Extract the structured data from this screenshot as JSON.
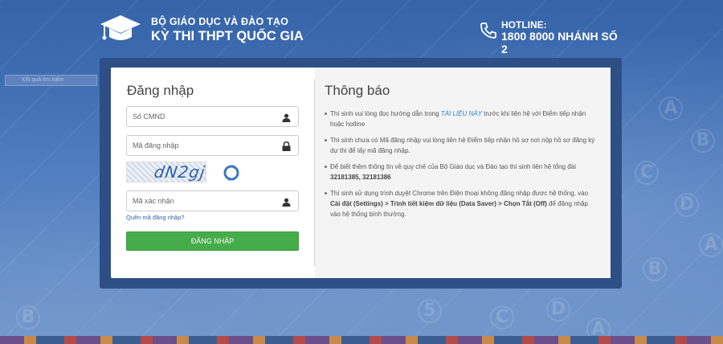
{
  "header": {
    "org": "BỘ GIÁO DỤC VÀ ĐÀO TẠO",
    "exam": "KỲ THI THPT QUỐC GIA",
    "hotline_label": "HOTLINE:",
    "hotline_number": "1800 8000 NHÁNH SỐ 2"
  },
  "login": {
    "title": "Đăng nhập",
    "id_placeholder": "Số CMND",
    "login_code_placeholder": "Mã đăng nhập",
    "captcha_text": "dN2gj",
    "captcha_input_placeholder": "Mã xác nhận",
    "forgot_link": "Quên mã đăng nhập?",
    "submit_label": "ĐĂNG NHẬP"
  },
  "notices": {
    "title": "Thông báo",
    "item1_before": "Thí sinh vui lòng đọc hướng dẫn trong ",
    "item1_link": "TÀI LIỆU NÀY",
    "item1_after": " trước khi liên hệ với Điểm tiếp nhận hoặc hotline",
    "item2": "Thí sinh chưa có Mã đăng nhập vui lòng liên hệ Điểm tiếp nhận hồ sơ nơi nộp hồ sơ đăng ký dự thi để lấy mã đăng nhập.",
    "item3_before": "Để biết thêm thông tin về quy chế của Bộ Giáo dục và Đào tạo thí sinh liên hệ tổng đài ",
    "item3_bold": "32181385, 32181386",
    "item4_before": "Thí sinh sử dụng trình duyệt Chrome trên Điện thoại không đăng nhập được hệ thống, vào ",
    "item4_bold": "Cài đặt (Settings) > Trình tiết kiệm dữ liệu (Data Saver) > Chọn Tắt (Off)",
    "item4_after": " để đăng nhập vào hệ thống bình thường."
  },
  "sidebar_stub": "Kết quả tìm kiếm",
  "icons": {
    "logo": "graduation-cap-icon",
    "phone": "phone-icon",
    "user": "user-icon",
    "lock": "lock-icon",
    "refresh": "refresh-icon"
  },
  "colors": {
    "background": "#3f6db0",
    "panel_frame": "#2d4f86",
    "submit": "#45ac49",
    "link": "#2f7fc1"
  }
}
